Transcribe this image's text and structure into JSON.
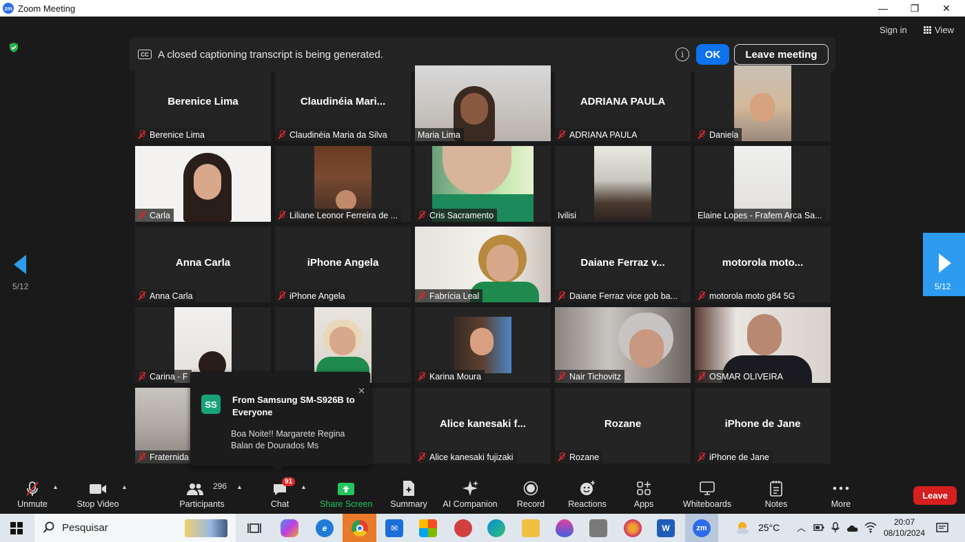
{
  "window": {
    "title": "Zoom Meeting",
    "logo_text": "zm",
    "minimize": "—",
    "restore": "❐",
    "close": "✕"
  },
  "caption_bar": {
    "cc_text": "CC",
    "message": "A closed captioning transcript is being generated.",
    "ok_label": "OK",
    "leave_meeting_label": "Leave meeting",
    "info_text": "i"
  },
  "header": {
    "sign_in": "Sign in",
    "view": "View"
  },
  "pagination": {
    "left_page": "5/12",
    "right_page": "5/12"
  },
  "tiles": [
    {
      "name": "Berenice Lima",
      "center_name": "Berenice Lima",
      "muted": true
    },
    {
      "name": "Claudinéia Maria da Silva",
      "center_name": "Claudinéia  Mari...",
      "muted": true
    },
    {
      "name": "Maria Lima",
      "center_name": "",
      "muted": false
    },
    {
      "name": "ADRIANA PAULA",
      "center_name": "ADRIANA PAULA",
      "muted": true
    },
    {
      "name": "Daniela",
      "center_name": "",
      "muted": true
    },
    {
      "name": "Carla",
      "center_name": "",
      "muted": true
    },
    {
      "name": "Liliane Leonor Ferreira de ...",
      "center_name": "",
      "muted": true
    },
    {
      "name": "Cris Sacramento",
      "center_name": "",
      "muted": true
    },
    {
      "name": "Ivilisi",
      "center_name": "",
      "muted": false
    },
    {
      "name": "Elaine Lopes - Frafem Arca Sa...",
      "center_name": "",
      "muted": false
    },
    {
      "name": "Anna Carla",
      "center_name": "Anna Carla",
      "muted": true
    },
    {
      "name": "iPhone Angela",
      "center_name": "iPhone Angela",
      "muted": true
    },
    {
      "name": "Fabrícia Leal",
      "center_name": "",
      "muted": true
    },
    {
      "name": "Daiane Ferraz  vice gob ba...",
      "center_name": "Daiane Ferraz  v...",
      "muted": true
    },
    {
      "name": "motorola moto g84 5G",
      "center_name": "motorola  moto...",
      "muted": true
    },
    {
      "name": "Carina - F",
      "center_name": "",
      "muted": true
    },
    {
      "name": "",
      "center_name": "",
      "muted": false
    },
    {
      "name": "Karina Moura",
      "center_name": "",
      "muted": true
    },
    {
      "name": "Nair Tichovitz",
      "center_name": "",
      "muted": true
    },
    {
      "name": "OSMAR OLIVEIRA",
      "center_name": "",
      "muted": true
    },
    {
      "name": "Fraternida",
      "center_name": "",
      "muted": true
    },
    {
      "name": "",
      "center_name": "",
      "muted": false
    },
    {
      "name": "Alice kanesaki fujizaki",
      "center_name": "Alice  kanesaki  f...",
      "muted": true
    },
    {
      "name": "Rozane",
      "center_name": "Rozane",
      "muted": true
    },
    {
      "name": "iPhone de Jane",
      "center_name": "iPhone de Jane",
      "muted": true
    }
  ],
  "chat_toast": {
    "avatar": "SS",
    "from": "From Samsung SM-S926B to Everyone",
    "message": "Boa Noite!! Margarete Regina Balan de Dourados Ms",
    "close": "✕"
  },
  "toolbar": {
    "unmute": "Unmute",
    "stop_video": "Stop Video",
    "participants": "Participants",
    "participants_count": "296",
    "chat": "Chat",
    "chat_badge": "91",
    "share_screen": "Share Screen",
    "summary": "Summary",
    "ai_companion": "AI Companion",
    "record": "Record",
    "reactions": "Reactions",
    "apps": "Apps",
    "whiteboards": "Whiteboards",
    "notes": "Notes",
    "more": "More",
    "leave": "Leave"
  },
  "taskbar": {
    "search": "Pesquisar",
    "weather": "25°C",
    "time": "20:07",
    "date": "08/10/2024",
    "zoom_icon": "zm",
    "word_icon": "W"
  },
  "colors": {
    "accent": "#0e72ed",
    "share_green": "#22c55e",
    "leave_red": "#d61f1f",
    "mute_red": "#e02828"
  }
}
